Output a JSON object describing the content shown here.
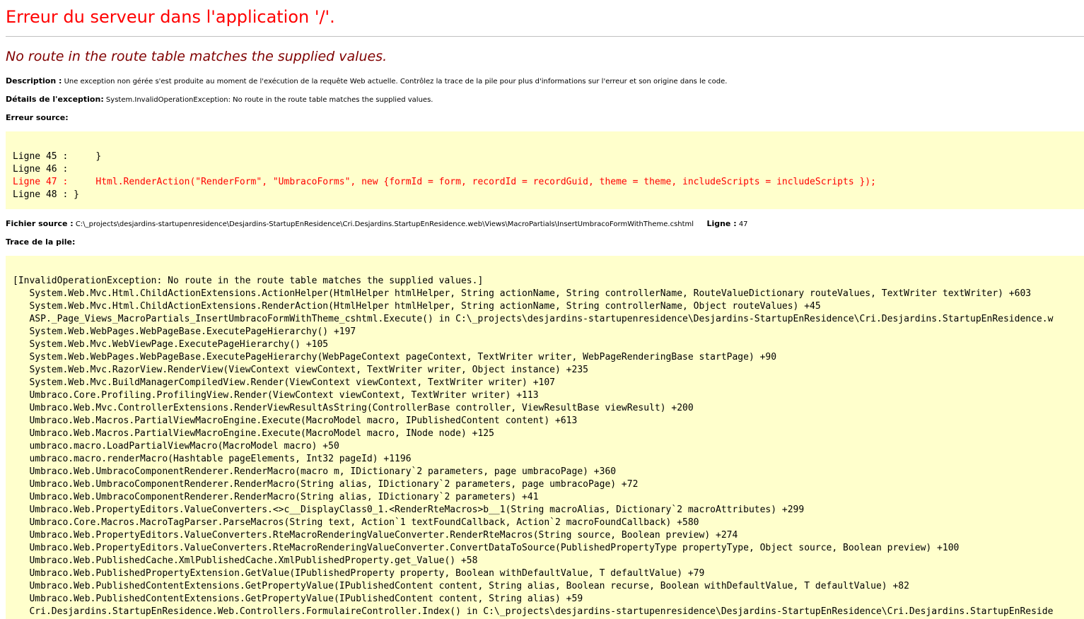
{
  "page": {
    "title": "Erreur du serveur dans l'application '/'.",
    "subtitle": "No route in the route table matches the supplied values."
  },
  "description": {
    "label": "Description :",
    "text": "Une exception non gérée s'est produite au moment de l'exécution de la requête Web actuelle. Contrôlez la trace de la pile pour plus d'informations sur l'erreur et son origine dans le code."
  },
  "exception_details": {
    "label": "Détails de l'exception:",
    "text": "System.InvalidOperationException: No route in the route table matches the supplied values."
  },
  "source_error": {
    "label": "Erreur source:",
    "lines": [
      {
        "text": "Ligne 45 :     }",
        "error": false
      },
      {
        "text": "Ligne 46 :",
        "error": false
      },
      {
        "text": "Ligne 47 :     Html.RenderAction(\"RenderForm\", \"UmbracoForms\", new {formId = form, recordId = recordGuid, theme = theme, includeScripts = includeScripts });",
        "error": true
      },
      {
        "text": "Ligne 48 : }",
        "error": false
      }
    ]
  },
  "source_file": {
    "label": "Fichier source :",
    "path": "C:\\_projects\\desjardins-startupenresidence\\Desjardins-StartupEnResidence\\Cri.Desjardins.StartupEnResidence.web\\Views\\MacroPartials\\InsertUmbracoFormWithTheme.cshtml",
    "line_label": "Ligne :",
    "line_value": "47"
  },
  "stack_trace": {
    "label": "Trace de la pile:",
    "lines": [
      "[InvalidOperationException: No route in the route table matches the supplied values.]",
      "   System.Web.Mvc.Html.ChildActionExtensions.ActionHelper(HtmlHelper htmlHelper, String actionName, String controllerName, RouteValueDictionary routeValues, TextWriter textWriter) +603",
      "   System.Web.Mvc.Html.ChildActionExtensions.RenderAction(HtmlHelper htmlHelper, String actionName, String controllerName, Object routeValues) +45",
      "   ASP._Page_Views_MacroPartials_InsertUmbracoFormWithTheme_cshtml.Execute() in C:\\_projects\\desjardins-startupenresidence\\Desjardins-StartupEnResidence\\Cri.Desjardins.StartupEnResidence.w",
      "   System.Web.WebPages.WebPageBase.ExecutePageHierarchy() +197",
      "   System.Web.Mvc.WebViewPage.ExecutePageHierarchy() +105",
      "   System.Web.WebPages.WebPageBase.ExecutePageHierarchy(WebPageContext pageContext, TextWriter writer, WebPageRenderingBase startPage) +90",
      "   System.Web.Mvc.RazorView.RenderView(ViewContext viewContext, TextWriter writer, Object instance) +235",
      "   System.Web.Mvc.BuildManagerCompiledView.Render(ViewContext viewContext, TextWriter writer) +107",
      "   Umbraco.Core.Profiling.ProfilingView.Render(ViewContext viewContext, TextWriter writer) +113",
      "   Umbraco.Web.Mvc.ControllerExtensions.RenderViewResultAsString(ControllerBase controller, ViewResultBase viewResult) +200",
      "   Umbraco.Web.Macros.PartialViewMacroEngine.Execute(MacroModel macro, IPublishedContent content) +613",
      "   Umbraco.Web.Macros.PartialViewMacroEngine.Execute(MacroModel macro, INode node) +125",
      "   umbraco.macro.LoadPartialViewMacro(MacroModel macro) +50",
      "   umbraco.macro.renderMacro(Hashtable pageElements, Int32 pageId) +1196",
      "   Umbraco.Web.UmbracoComponentRenderer.RenderMacro(macro m, IDictionary`2 parameters, page umbracoPage) +360",
      "   Umbraco.Web.UmbracoComponentRenderer.RenderMacro(String alias, IDictionary`2 parameters, page umbracoPage) +72",
      "   Umbraco.Web.UmbracoComponentRenderer.RenderMacro(String alias, IDictionary`2 parameters) +41",
      "   Umbraco.Web.PropertyEditors.ValueConverters.<>c__DisplayClass0_1.<RenderRteMacros>b__1(String macroAlias, Dictionary`2 macroAttributes) +299",
      "   Umbraco.Core.Macros.MacroTagParser.ParseMacros(String text, Action`1 textFoundCallback, Action`2 macroFoundCallback) +580",
      "   Umbraco.Web.PropertyEditors.ValueConverters.RteMacroRenderingValueConverter.RenderRteMacros(String source, Boolean preview) +274",
      "   Umbraco.Web.PropertyEditors.ValueConverters.RteMacroRenderingValueConverter.ConvertDataToSource(PublishedPropertyType propertyType, Object source, Boolean preview) +100",
      "   Umbraco.Web.PublishedCache.XmlPublishedCache.XmlPublishedProperty.get_Value() +58",
      "   Umbraco.Web.PublishedPropertyExtension.GetValue(IPublishedProperty property, Boolean withDefaultValue, T defaultValue) +79",
      "   Umbraco.Web.PublishedContentExtensions.GetPropertyValue(IPublishedContent content, String alias, Boolean recurse, Boolean withDefaultValue, T defaultValue) +82",
      "   Umbraco.Web.PublishedContentExtensions.GetPropertyValue(IPublishedContent content, String alias) +59",
      "   Cri.Desjardins.StartupEnResidence.Web.Controllers.FormulaireController.Index() in C:\\_projects\\desjardins-startupenresidence\\Desjardins-StartupEnResidence\\Cri.Desjardins.StartupEnReside"
    ]
  }
}
